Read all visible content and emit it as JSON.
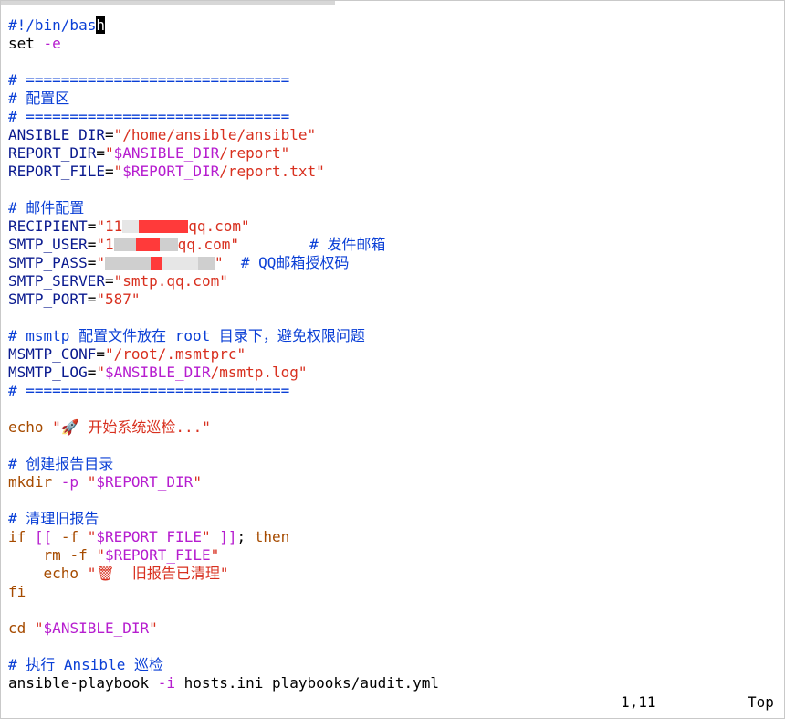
{
  "editor": {
    "lines": [
      {
        "segments": [
          {
            "text": "#!/bin/bas",
            "cls": "cmt"
          },
          {
            "text": "h",
            "cls": "cursor"
          }
        ]
      },
      {
        "segments": [
          {
            "text": "set ",
            "cls": ""
          },
          {
            "text": "-e",
            "cls": "opt"
          }
        ]
      },
      {
        "segments": []
      },
      {
        "segments": [
          {
            "text": "# ==============================",
            "cls": "cmt"
          }
        ]
      },
      {
        "segments": [
          {
            "text": "# 配置区",
            "cls": "cmt"
          }
        ]
      },
      {
        "segments": [
          {
            "text": "# ==============================",
            "cls": "cmt"
          }
        ]
      },
      {
        "segments": [
          {
            "text": "ANSIBLE_DIR",
            "cls": "ident"
          },
          {
            "text": "=",
            "cls": ""
          },
          {
            "text": "\"/home/ansible/ansible\"",
            "cls": "str"
          }
        ]
      },
      {
        "segments": [
          {
            "text": "REPORT_DIR",
            "cls": "ident"
          },
          {
            "text": "=",
            "cls": ""
          },
          {
            "text": "\"",
            "cls": "str"
          },
          {
            "text": "$ANSIBLE_DIR",
            "cls": "var"
          },
          {
            "text": "/report\"",
            "cls": "str"
          }
        ]
      },
      {
        "segments": [
          {
            "text": "REPORT_FILE",
            "cls": "ident"
          },
          {
            "text": "=",
            "cls": ""
          },
          {
            "text": "\"",
            "cls": "str"
          },
          {
            "text": "$REPORT_DIR",
            "cls": "var"
          },
          {
            "text": "/report.txt\"",
            "cls": "str"
          }
        ]
      },
      {
        "segments": []
      },
      {
        "segments": [
          {
            "text": "# 邮件配置",
            "cls": "cmt"
          }
        ]
      },
      {
        "segments": [
          {
            "text": "RECIPIENT",
            "cls": "ident"
          },
          {
            "text": "=",
            "cls": ""
          },
          {
            "text": "\"11",
            "cls": "str"
          },
          {
            "redact": [
              18,
              "r3"
            ]
          },
          {
            "redact": [
              54,
              "r1"
            ]
          },
          {
            "text": "qq.com\"",
            "cls": "str"
          }
        ]
      },
      {
        "segments": [
          {
            "text": "SMTP_USER",
            "cls": "ident"
          },
          {
            "text": "=",
            "cls": ""
          },
          {
            "text": "\"1",
            "cls": "str"
          },
          {
            "redact": [
              24,
              "r2"
            ]
          },
          {
            "redact": [
              26,
              "r1"
            ]
          },
          {
            "redact": [
              20,
              "r2"
            ]
          },
          {
            "text": "qq.com\"",
            "cls": "str"
          },
          {
            "text": "        # 发件邮箱",
            "cls": "cmt"
          }
        ]
      },
      {
        "segments": [
          {
            "text": "SMTP_PASS",
            "cls": "ident"
          },
          {
            "text": "=",
            "cls": ""
          },
          {
            "text": "\"",
            "cls": "str"
          },
          {
            "redact": [
              50,
              "r2"
            ]
          },
          {
            "redact": [
              12,
              "r1"
            ]
          },
          {
            "redact": [
              40,
              "r3"
            ]
          },
          {
            "redact": [
              18,
              "r2"
            ]
          },
          {
            "text": "\"",
            "cls": "str"
          },
          {
            "text": "  # QQ邮箱授权码",
            "cls": "cmt"
          }
        ]
      },
      {
        "segments": [
          {
            "text": "SMTP_SERVER",
            "cls": "ident"
          },
          {
            "text": "=",
            "cls": ""
          },
          {
            "text": "\"smtp.qq.com\"",
            "cls": "str"
          }
        ]
      },
      {
        "segments": [
          {
            "text": "SMTP_PORT",
            "cls": "ident"
          },
          {
            "text": "=",
            "cls": ""
          },
          {
            "text": "\"587\"",
            "cls": "str"
          }
        ]
      },
      {
        "segments": []
      },
      {
        "segments": [
          {
            "text": "# msmtp 配置文件放在 root 目录下，避免权限问题",
            "cls": "cmt"
          }
        ]
      },
      {
        "segments": [
          {
            "text": "MSMTP_CONF",
            "cls": "ident"
          },
          {
            "text": "=",
            "cls": ""
          },
          {
            "text": "\"/root/.msmtprc\"",
            "cls": "str"
          }
        ]
      },
      {
        "segments": [
          {
            "text": "MSMTP_LOG",
            "cls": "ident"
          },
          {
            "text": "=",
            "cls": ""
          },
          {
            "text": "\"",
            "cls": "str"
          },
          {
            "text": "$ANSIBLE_DIR",
            "cls": "var"
          },
          {
            "text": "/msmtp.log\"",
            "cls": "str"
          }
        ]
      },
      {
        "segments": [
          {
            "text": "# ==============================",
            "cls": "cmt"
          }
        ]
      },
      {
        "segments": []
      },
      {
        "segments": [
          {
            "text": "echo ",
            "cls": "kw"
          },
          {
            "text": "\"🚀 开始系统巡检...\"",
            "cls": "str"
          }
        ]
      },
      {
        "segments": []
      },
      {
        "segments": [
          {
            "text": "# 创建报告目录",
            "cls": "cmt"
          }
        ]
      },
      {
        "segments": [
          {
            "text": "mkdir ",
            "cls": "kw"
          },
          {
            "text": "-p ",
            "cls": "opt"
          },
          {
            "text": "\"",
            "cls": "str"
          },
          {
            "text": "$REPORT_DIR",
            "cls": "var"
          },
          {
            "text": "\"",
            "cls": "str"
          }
        ]
      },
      {
        "segments": []
      },
      {
        "segments": [
          {
            "text": "# 清理旧报告",
            "cls": "cmt"
          }
        ]
      },
      {
        "segments": [
          {
            "text": "if ",
            "cls": "kw"
          },
          {
            "text": "[[ ",
            "cls": "opt"
          },
          {
            "text": "-f ",
            "cls": "kw"
          },
          {
            "text": "\"",
            "cls": "str"
          },
          {
            "text": "$REPORT_FILE",
            "cls": "var"
          },
          {
            "text": "\"",
            "cls": "str"
          },
          {
            "text": " ]]",
            "cls": "opt"
          },
          {
            "text": "; ",
            "cls": ""
          },
          {
            "text": "then",
            "cls": "kw"
          }
        ]
      },
      {
        "segments": [
          {
            "text": "    rm ",
            "cls": "kw"
          },
          {
            "text": "-f ",
            "cls": "kw"
          },
          {
            "text": "\"",
            "cls": "str"
          },
          {
            "text": "$REPORT_FILE",
            "cls": "var"
          },
          {
            "text": "\"",
            "cls": "str"
          }
        ]
      },
      {
        "segments": [
          {
            "text": "    echo ",
            "cls": "kw"
          },
          {
            "text": "\"🗑  旧报告已清理\"",
            "cls": "str"
          }
        ]
      },
      {
        "segments": [
          {
            "text": "fi",
            "cls": "kw"
          }
        ]
      },
      {
        "segments": []
      },
      {
        "segments": [
          {
            "text": "cd ",
            "cls": "kw"
          },
          {
            "text": "\"",
            "cls": "str"
          },
          {
            "text": "$ANSIBLE_DIR",
            "cls": "var"
          },
          {
            "text": "\"",
            "cls": "str"
          }
        ]
      },
      {
        "segments": []
      },
      {
        "segments": [
          {
            "text": "# 执行 Ansible 巡检",
            "cls": "cmt"
          }
        ]
      },
      {
        "segments": [
          {
            "text": "ansible-playbook ",
            "cls": ""
          },
          {
            "text": "-i",
            "cls": "opt"
          },
          {
            "text": " hosts.ini playbooks/audit.yml",
            "cls": ""
          }
        ]
      }
    ]
  },
  "statusline": {
    "cursor_position": "1,11",
    "scroll": "Top"
  },
  "colors": {
    "comment": "#0a3fd6",
    "string": "#d8301f",
    "variable": "#b61dcf",
    "keyword": "#a64b00",
    "identifier": "#0a1a8f"
  }
}
